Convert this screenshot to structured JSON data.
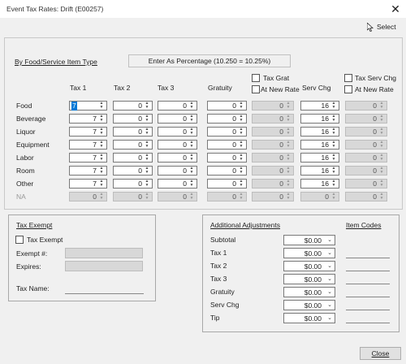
{
  "window": {
    "title": "Event Tax Rates: Drift (E00257)",
    "close_glyph": "✕"
  },
  "toolbar": {
    "select_label": "Select"
  },
  "rates": {
    "header_link": "By Food/Service Item Type",
    "header_note": "Enter As Percentage (10.250 = 10.25%)",
    "columns": {
      "tax1": "Tax 1",
      "tax2": "Tax 2",
      "tax3": "Tax 3",
      "gratuity": "Gratuity",
      "tax_grat": "Tax Grat",
      "at_new_rate_1": "At New Rate",
      "serv_chg": "Serv Chg",
      "tax_serv_chg": "Tax Serv Chg",
      "at_new_rate_2": "At New Rate"
    },
    "rows": [
      {
        "label": "Food",
        "tax1": "7",
        "tax2": "0",
        "tax3": "0",
        "gratuity": "0",
        "tax_grat": "0",
        "serv_chg": "16",
        "tax_serv_chg": "0"
      },
      {
        "label": "Beverage",
        "tax1": "7",
        "tax2": "0",
        "tax3": "0",
        "gratuity": "0",
        "tax_grat": "0",
        "serv_chg": "16",
        "tax_serv_chg": "0"
      },
      {
        "label": "Liquor",
        "tax1": "7",
        "tax2": "0",
        "tax3": "0",
        "gratuity": "0",
        "tax_grat": "0",
        "serv_chg": "16",
        "tax_serv_chg": "0"
      },
      {
        "label": "Equipment",
        "tax1": "7",
        "tax2": "0",
        "tax3": "0",
        "gratuity": "0",
        "tax_grat": "0",
        "serv_chg": "16",
        "tax_serv_chg": "0"
      },
      {
        "label": "Labor",
        "tax1": "7",
        "tax2": "0",
        "tax3": "0",
        "gratuity": "0",
        "tax_grat": "0",
        "serv_chg": "16",
        "tax_serv_chg": "0"
      },
      {
        "label": "Room",
        "tax1": "7",
        "tax2": "0",
        "tax3": "0",
        "gratuity": "0",
        "tax_grat": "0",
        "serv_chg": "16",
        "tax_serv_chg": "0"
      },
      {
        "label": "Other",
        "tax1": "7",
        "tax2": "0",
        "tax3": "0",
        "gratuity": "0",
        "tax_grat": "0",
        "serv_chg": "16",
        "tax_serv_chg": "0"
      },
      {
        "label": "NA",
        "tax1": "0",
        "tax2": "0",
        "tax3": "0",
        "gratuity": "0",
        "tax_grat": "0",
        "serv_chg": "0",
        "tax_serv_chg": "0"
      }
    ]
  },
  "tax_exempt": {
    "title": "Tax Exempt",
    "checkbox_label": "Tax Exempt",
    "exempt_no_label": "Exempt #:",
    "expires_label": "Expires:",
    "tax_name_label": "Tax Name:"
  },
  "adjustments": {
    "title": "Additional Adjustments",
    "item_codes_title": "Item Codes",
    "rows": [
      {
        "label": "Subtotal",
        "value": "$0.00"
      },
      {
        "label": "Tax 1",
        "value": "$0.00"
      },
      {
        "label": "Tax 2",
        "value": "$0.00"
      },
      {
        "label": "Tax 3",
        "value": "$0.00"
      },
      {
        "label": "Gratuity",
        "value": "$0.00"
      },
      {
        "label": "Serv Chg",
        "value": "$0.00"
      },
      {
        "label": "Tip",
        "value": "$0.00"
      }
    ]
  },
  "footer": {
    "close_label": "Close"
  }
}
